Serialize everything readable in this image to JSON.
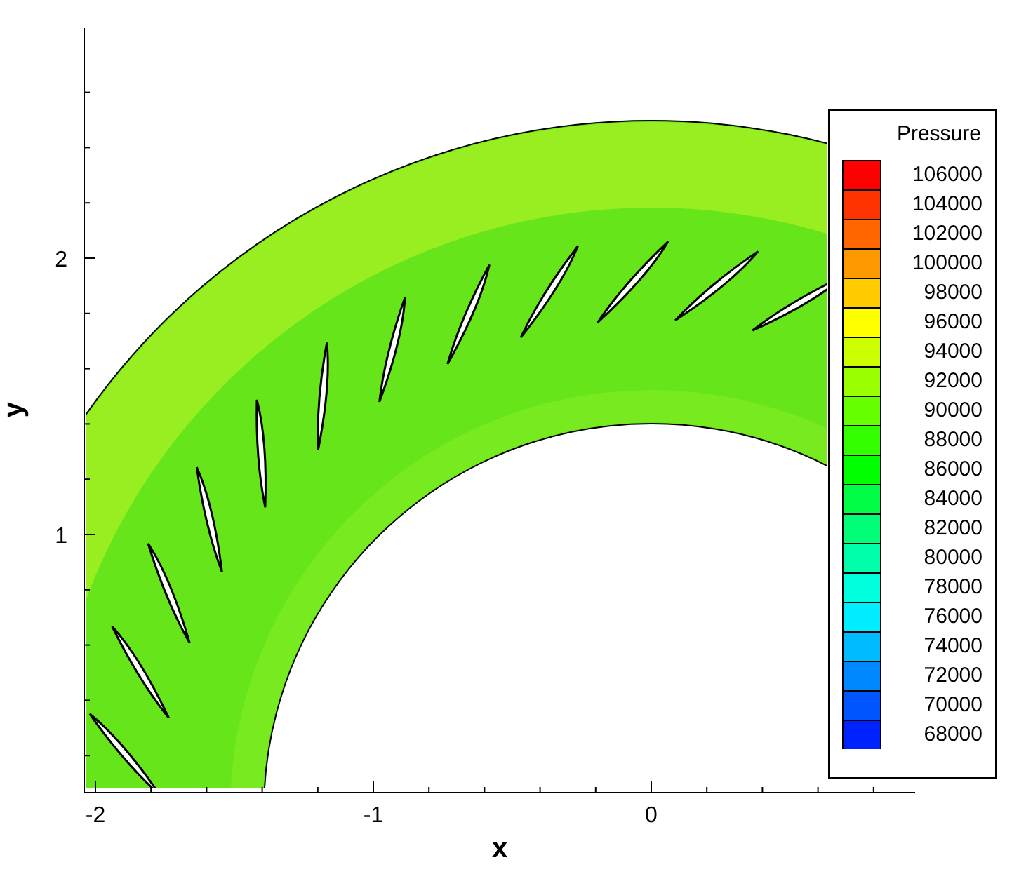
{
  "plot": {
    "x_axis": {
      "label": "x",
      "ticks": [
        {
          "label": "-2"
        },
        {
          "label": "-1"
        },
        {
          "label": "0"
        }
      ]
    },
    "y_axis": {
      "label": "y",
      "ticks": [
        {
          "label": "2"
        },
        {
          "label": "1"
        }
      ]
    }
  },
  "legend": {
    "title": "Pressure",
    "levels": [
      {
        "label": "106000",
        "color": "#ff0000"
      },
      {
        "label": "104000",
        "color": "#ff3300"
      },
      {
        "label": "102000",
        "color": "#ff6600"
      },
      {
        "label": "100000",
        "color": "#ff9900"
      },
      {
        "label": "98000",
        "color": "#ffcc00"
      },
      {
        "label": "96000",
        "color": "#ffff00"
      },
      {
        "label": "94000",
        "color": "#ccff00"
      },
      {
        "label": "92000",
        "color": "#99ff00"
      },
      {
        "label": "90000",
        "color": "#66ff00"
      },
      {
        "label": "88000",
        "color": "#33ff00"
      },
      {
        "label": "86000",
        "color": "#00ff00"
      },
      {
        "label": "84000",
        "color": "#00ff44"
      },
      {
        "label": "82000",
        "color": "#00ff77"
      },
      {
        "label": "80000",
        "color": "#00ffaa"
      },
      {
        "label": "78000",
        "color": "#00ffdd"
      },
      {
        "label": "76000",
        "color": "#00eeff"
      },
      {
        "label": "74000",
        "color": "#00bbff"
      },
      {
        "label": "72000",
        "color": "#0088ff"
      },
      {
        "label": "70000",
        "color": "#0055ff"
      },
      {
        "label": "68000",
        "color": "#0022ff"
      }
    ]
  }
}
